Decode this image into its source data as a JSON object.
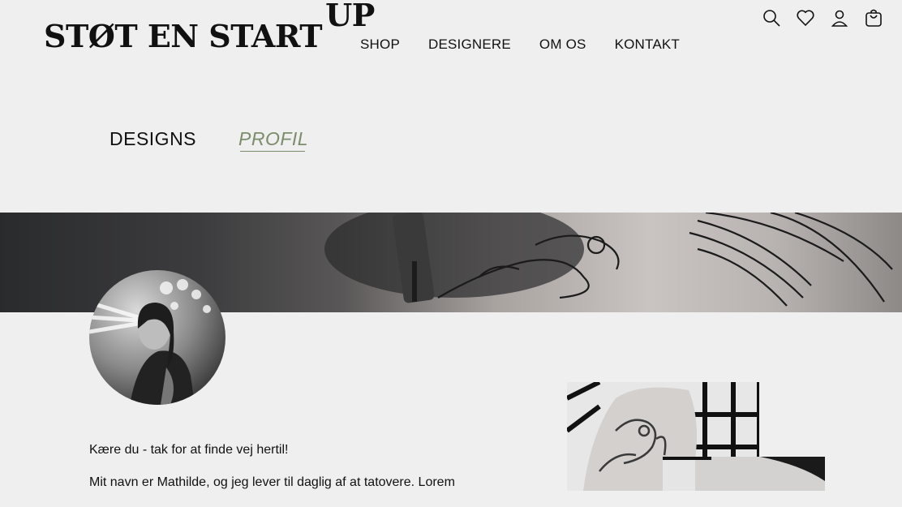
{
  "header": {
    "logo_main": "STØT EN START",
    "logo_sup": "UP",
    "nav": [
      {
        "label": "SHOP"
      },
      {
        "label": "DESIGNERE"
      },
      {
        "label": "OM OS"
      },
      {
        "label": "KONTAKT"
      }
    ],
    "icons": [
      "search-icon",
      "heart-icon",
      "user-icon",
      "shopping-bag-icon"
    ]
  },
  "tabs": [
    {
      "label": "DESIGNS",
      "active": false
    },
    {
      "label": "PROFIL",
      "active": true
    }
  ],
  "colors": {
    "background": "#efefef",
    "accent": "#7b8d6b",
    "text": "#111111"
  },
  "profile": {
    "intro": [
      "Kære du - tak for at finde vej hertil!",
      "Mit navn er Mathilde, og jeg lever til daglig af at tatovere. Lorem"
    ]
  }
}
